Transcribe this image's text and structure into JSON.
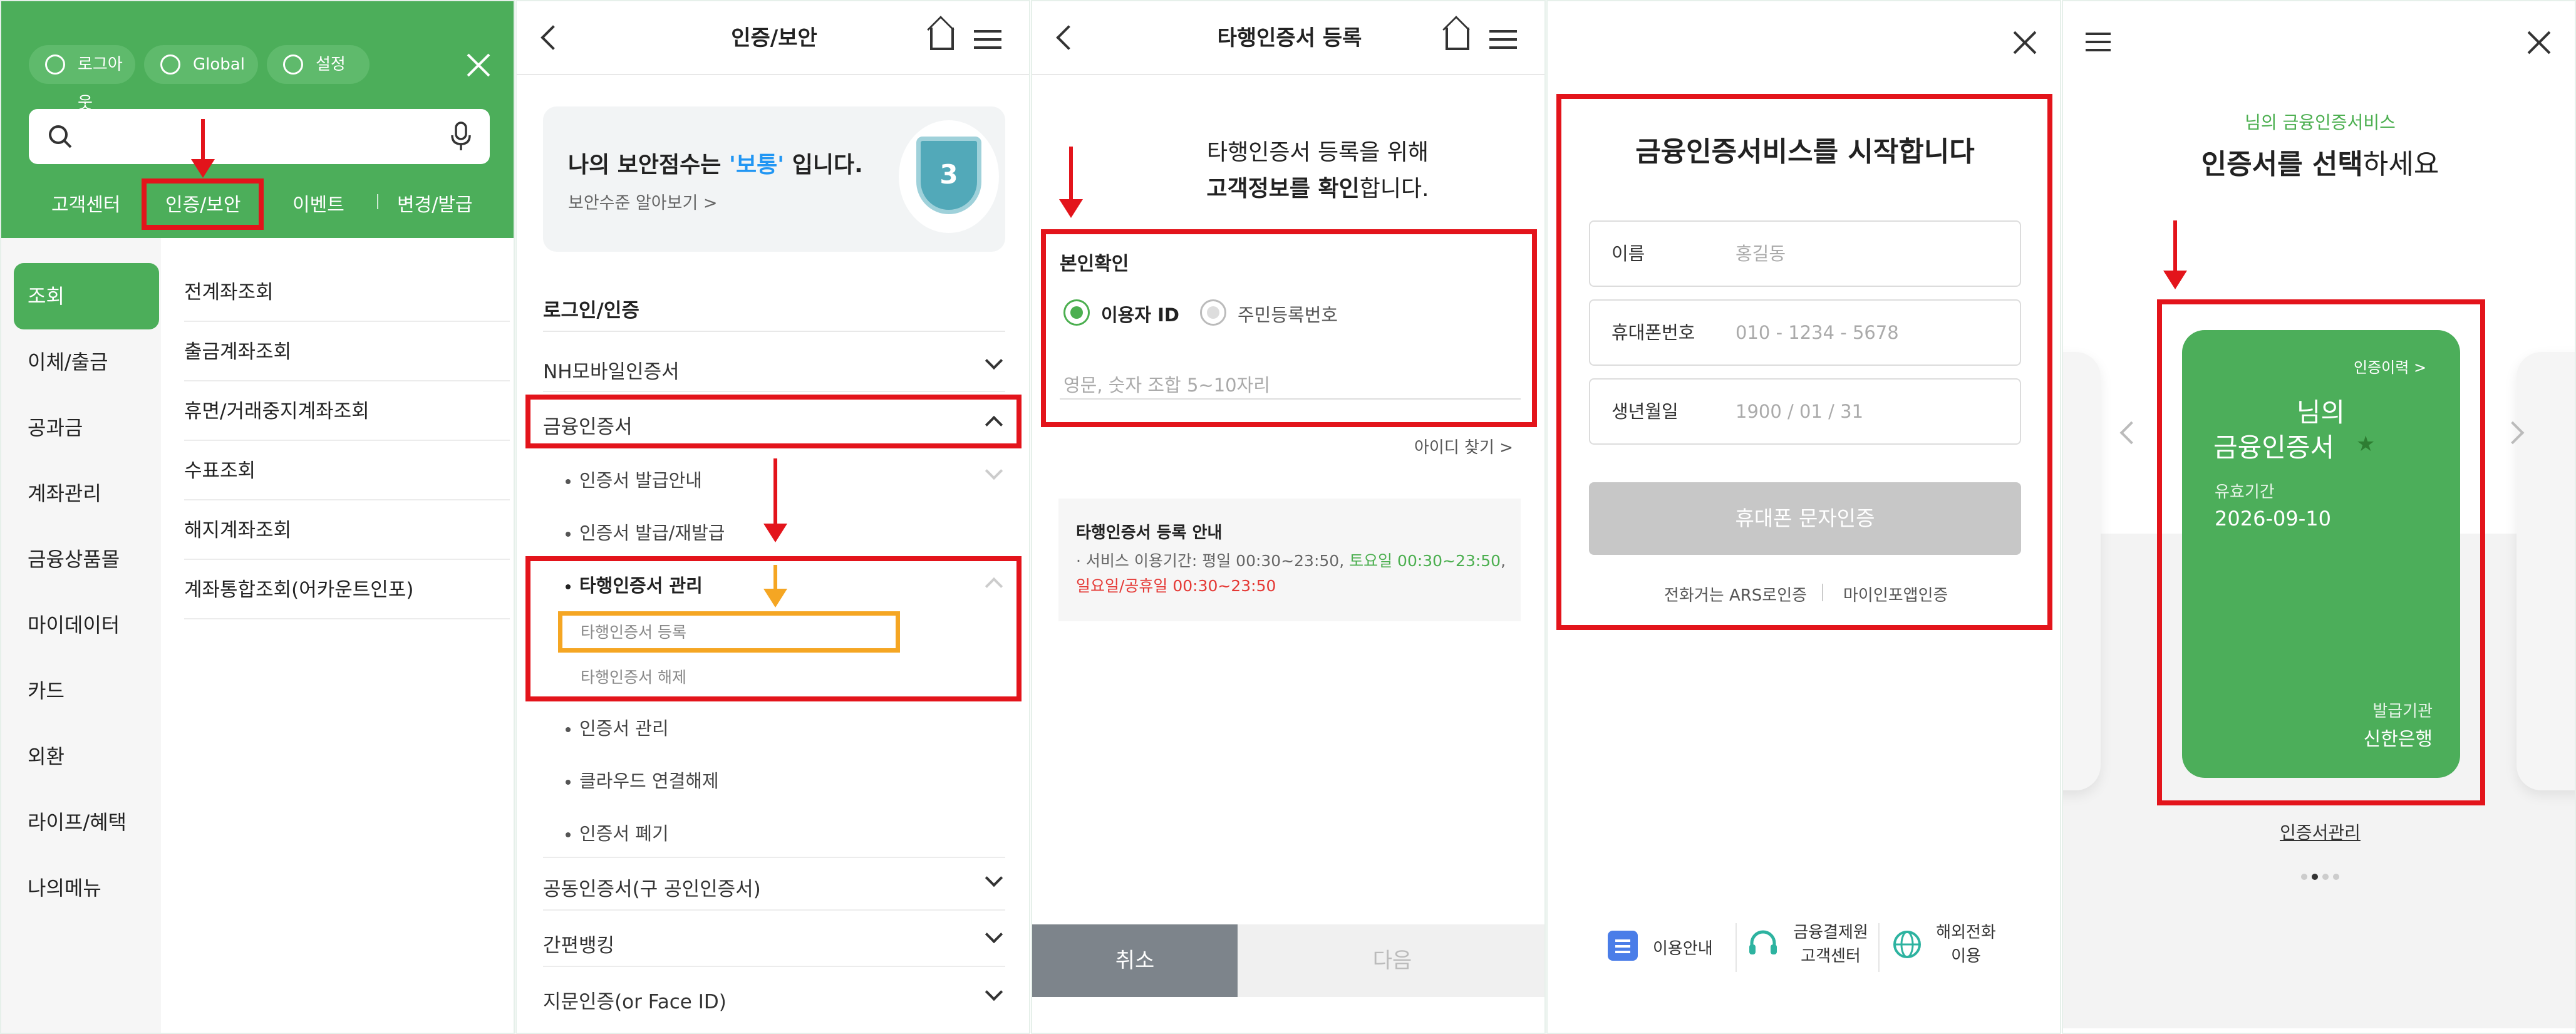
{
  "colors": {
    "brand_green": "#4cae5a",
    "highlight_red": "#e3141b",
    "highlight_orange": "#f5a623"
  },
  "panel1": {
    "pills": {
      "logout": "로그아웃",
      "global": "Global",
      "settings": "설정"
    },
    "topnav": [
      "고객센터",
      "인증/보안",
      "이벤트",
      "변경/발급"
    ],
    "side_menu": [
      "조회",
      "이체/출금",
      "공과금",
      "계좌관리",
      "금융상품몰",
      "마이데이터",
      "카드",
      "외환",
      "라이프/혜택",
      "나의메뉴"
    ],
    "sub_menu": [
      "전계좌조회",
      "출금계좌조회",
      "휴면/거래중지계좌조회",
      "수표조회",
      "해지계좌조회",
      "계좌통합조회(어카운트인포)"
    ]
  },
  "panel2": {
    "title": "인증/보안",
    "score_prefix": "나의 보안점수는 ",
    "score_value": "'보통'",
    "score_suffix": " 입니다.",
    "score_link": "보안수준 알아보기 >",
    "shield_number": "3",
    "section": "로그인/인증",
    "rows": {
      "nh_mobile": "NH모바일인증서",
      "financial": "금융인증서",
      "issue_guide": "인증서 발급안내",
      "issue_reissue": "인증서 발급/재발급",
      "other_mgmt": "타행인증서 관리",
      "other_register": "타행인증서 등록",
      "other_cancel": "타행인증서 해제",
      "cert_mgmt": "인증서 관리",
      "cloud_disconnect": "클라우드 연결해제",
      "cert_revoke": "인증서 폐기",
      "joint_cert": "공동인증서(구 공인인증서)",
      "simple_banking": "간편뱅킹",
      "biometric": "지문인증(or Face ID)"
    }
  },
  "panel3": {
    "title": "타행인증서 등록",
    "intro_line1": "타행인증서 등록을 위해",
    "intro_line2_bold": "고객정보를 확인",
    "intro_line2_rest": "합니다.",
    "box_title": "본인확인",
    "radio_user_id": "이용자 ID",
    "radio_resident": "주민등록번호",
    "id_placeholder": "영문, 숫자 조합 5~10자리",
    "find_id": "아이디 찾기 >",
    "notice_title": "타행인증서 등록 안내",
    "notice_prefix": "· 서비스 이용기간: 평일 00:30~23:50, ",
    "notice_sat": "토요일 00:30~23:50",
    "notice_sep": ", ",
    "notice_sun": "일요일/공휴일 00:30~23:50",
    "cancel": "취소",
    "next": "다음"
  },
  "panel4": {
    "title": "금융인증서비스를 시작합니다",
    "fields": [
      {
        "label": "이름",
        "value": "홍길동"
      },
      {
        "label": "휴대폰번호",
        "value": "010 - 1234 - 5678"
      },
      {
        "label": "생년월일",
        "value": "1900 / 01 / 31"
      }
    ],
    "verify_button": "휴대폰 문자인증",
    "ars": "전화거는 ARS로인증",
    "mydata_app": "마이인포앱인증",
    "footer": {
      "guide": "이용안내",
      "center_line1": "금융결제원",
      "center_line2": "고객센터",
      "intl_line1": "해외전화",
      "intl_line2": "이용"
    }
  },
  "panel5": {
    "subtitle": "님의 금융인증서비스",
    "heading_bold": "인증서를 선택",
    "heading_rest": "하세요",
    "card_history": "인증이력 >",
    "card_owner": "님의",
    "card_name": "금융인증서",
    "validity_label": "유효기간",
    "validity_date": "2026-09-10",
    "issuer_label": "발급기관",
    "issuer": "신한은행",
    "manage_link": "인증서관리",
    "page_indicator": {
      "current": 2,
      "total": 4
    }
  }
}
